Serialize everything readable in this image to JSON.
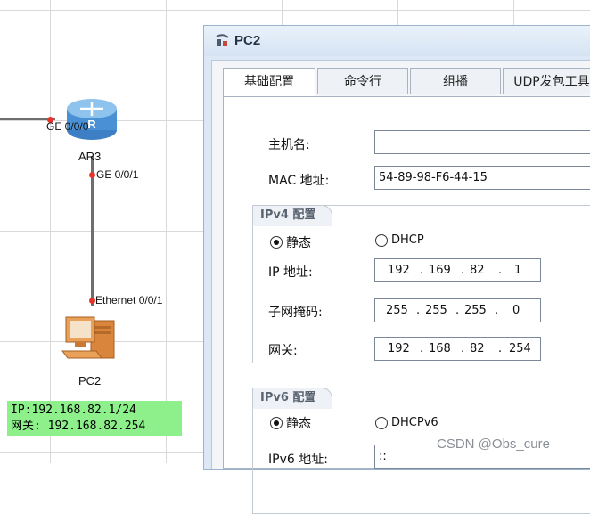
{
  "topology": {
    "router": {
      "name": "AR3",
      "port_left": "GE 0/0/0",
      "port_bottom": "GE 0/0/1"
    },
    "pc": {
      "name": "PC2",
      "port": "Ethernet 0/0/1",
      "note_line1": "IP:192.168.82.1/24",
      "note_line2": "网关: 192.168.82.254"
    },
    "colors": {
      "link": "#6e6e6e",
      "port_dot": "#e8332a",
      "note_bg": "#8df08b"
    }
  },
  "window": {
    "title": "PC2",
    "icon": "ensp-app-icon",
    "tabs": [
      {
        "label": "基础配置",
        "active": true
      },
      {
        "label": "命令行",
        "active": false
      },
      {
        "label": "组播",
        "active": false
      },
      {
        "label": "UDP发包工具",
        "active": false
      }
    ],
    "form": {
      "hostname_label": "主机名:",
      "hostname_value": "",
      "mac_label": "MAC 地址:",
      "mac_value": "54-89-98-F6-44-15",
      "ipv4": {
        "group_title": "IPv4 配置",
        "static_label": "静态",
        "dhcp_label": "DHCP",
        "ip_label": "IP 地址:",
        "ip": [
          "192",
          "169",
          "82",
          "1"
        ],
        "mask_label": "子网掩码:",
        "mask": [
          "255",
          "255",
          "255",
          "0"
        ],
        "gateway_label": "网关:",
        "gateway": [
          "192",
          "168",
          "82",
          "254"
        ]
      },
      "ipv6": {
        "group_title": "IPv6 配置",
        "static_label": "静态",
        "dhcp_label": "DHCPv6",
        "ip_label": "IPv6 地址:",
        "ip_value": "::"
      }
    }
  },
  "watermark": "CSDN @Obs_cure"
}
